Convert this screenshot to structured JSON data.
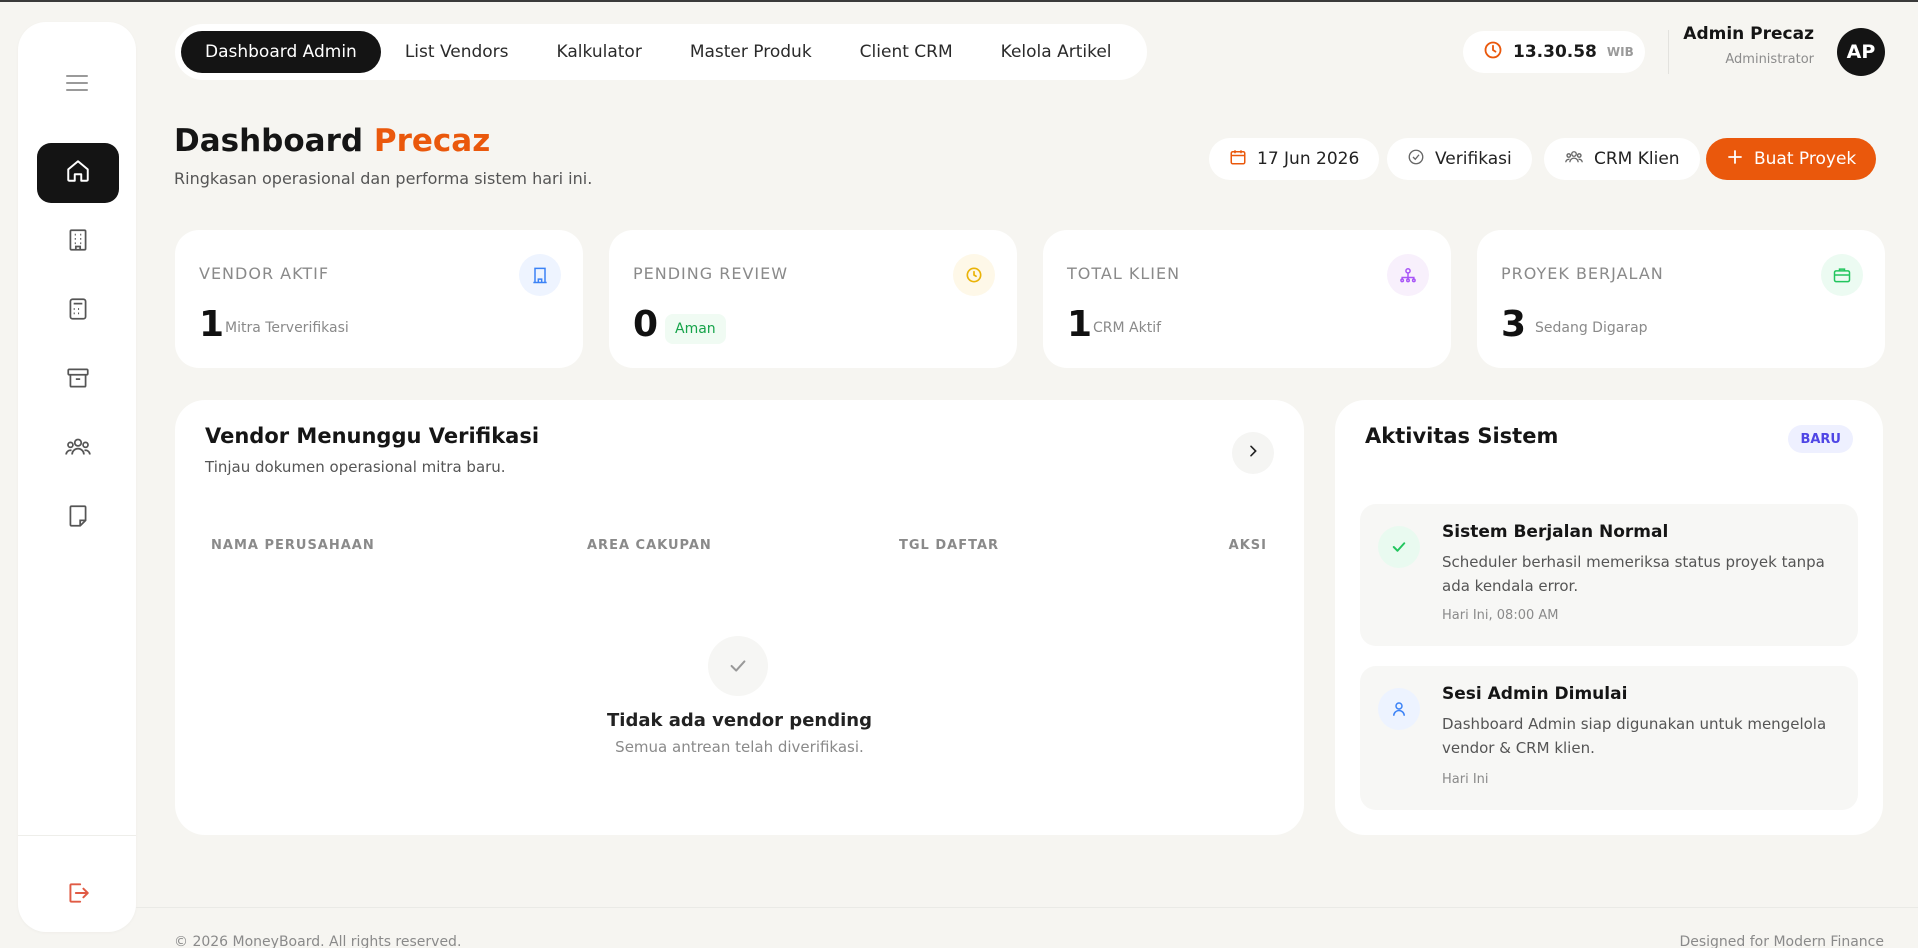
{
  "topnav": {
    "tabs": [
      {
        "label": "Dashboard Admin",
        "active": true
      },
      {
        "label": "List Vendors",
        "active": false
      },
      {
        "label": "Kalkulator",
        "active": false
      },
      {
        "label": "Master Produk",
        "active": false
      },
      {
        "label": "Client CRM",
        "active": false
      },
      {
        "label": "Kelola Artikel",
        "active": false
      }
    ],
    "clock": {
      "time": "13.30.58",
      "zone": "WIB"
    },
    "user": {
      "name": "Admin Precaz",
      "role": "Administrator",
      "initials": "AP"
    }
  },
  "sidebar": {
    "items": [
      {
        "icon": "home-icon",
        "active": true
      },
      {
        "icon": "building-icon",
        "active": false
      },
      {
        "icon": "calculator-icon",
        "active": false
      },
      {
        "icon": "archive-icon",
        "active": false
      },
      {
        "icon": "users-icon",
        "active": false
      },
      {
        "icon": "document-icon",
        "active": false
      }
    ],
    "logout_icon": "logout-icon"
  },
  "header": {
    "title_main": "Dashboard ",
    "title_accent": "Precaz",
    "subtitle": "Ringkasan operasional dan performa sistem hari ini.",
    "date": "17 Jun 2026",
    "verify_label": "Verifikasi",
    "crm_label": "CRM Klien",
    "create_label": "Buat Proyek"
  },
  "stats": [
    {
      "label": "VENDOR AKTIF",
      "value": "1",
      "sub": "Mitra Terverifikasi",
      "icon": "building-icon"
    },
    {
      "label": "PENDING REVIEW",
      "value": "0",
      "badge": "Aman",
      "icon": "clock-icon"
    },
    {
      "label": "TOTAL KLIEN",
      "value": "1",
      "sub": "CRM Aktif",
      "icon": "network-icon"
    },
    {
      "label": "PROYEK BERJALAN",
      "value": "3",
      "sub": "Sedang Digarap",
      "icon": "briefcase-icon"
    }
  ],
  "colors": {
    "accent": "#ea580c",
    "dark": "#141414",
    "background": "#f6f5f1"
  },
  "vendors_panel": {
    "title": "Vendor Menunggu Verifikasi",
    "subtitle": "Tinjau dokumen operasional mitra baru.",
    "columns": [
      "NAMA PERUSAHAAN",
      "AREA CAKUPAN",
      "TGL DAFTAR",
      "AKSI"
    ],
    "empty_title": "Tidak ada vendor pending",
    "empty_sub": "Semua antrean telah diverifikasi."
  },
  "activity": {
    "title": "Aktivitas Sistem",
    "badge": "BARU",
    "items": [
      {
        "title": "Sistem Berjalan Normal",
        "desc": "Scheduler berhasil memeriksa status proyek tanpa ada kendala error.",
        "time": "Hari Ini, 08:00 AM",
        "icon": "check-icon"
      },
      {
        "title": "Sesi Admin Dimulai",
        "desc": "Dashboard Admin siap digunakan untuk mengelola vendor & CRM klien.",
        "time": "Hari Ini",
        "icon": "user-icon"
      }
    ]
  },
  "footer": {
    "copyright": "© 2026 MoneyBoard. All rights reserved.",
    "tagline": "Designed for Modern Finance"
  }
}
